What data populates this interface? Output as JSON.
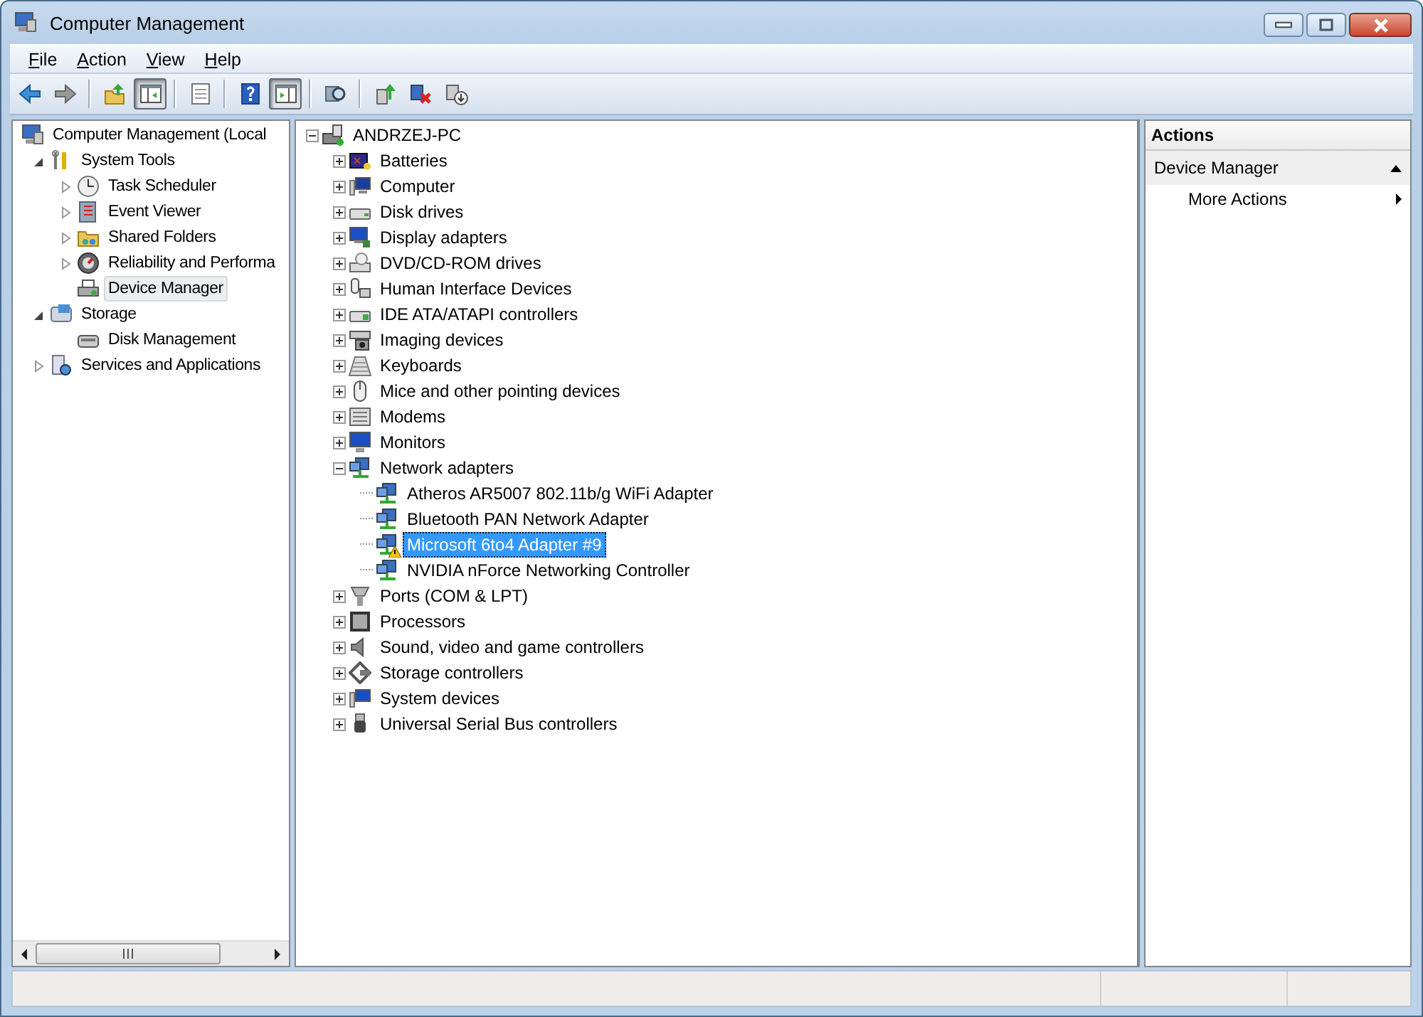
{
  "window": {
    "title": "Computer Management"
  },
  "menu": [
    {
      "label": "File"
    },
    {
      "label": "Action"
    },
    {
      "label": "View"
    },
    {
      "label": "Help"
    }
  ],
  "toolbar": [
    {
      "kind": "back",
      "pressed": false
    },
    {
      "kind": "forward",
      "pressed": false
    },
    {
      "kind": "separator"
    },
    {
      "kind": "up",
      "pressed": false
    },
    {
      "kind": "console-tree",
      "pressed": true
    },
    {
      "kind": "separator"
    },
    {
      "kind": "export",
      "pressed": false
    },
    {
      "kind": "separator"
    },
    {
      "kind": "help",
      "pressed": false
    },
    {
      "kind": "action-pane",
      "pressed": true
    },
    {
      "kind": "separator"
    },
    {
      "kind": "scan",
      "pressed": false
    },
    {
      "kind": "separator"
    },
    {
      "kind": "update",
      "pressed": false
    },
    {
      "kind": "uninstall",
      "pressed": false
    },
    {
      "kind": "disable",
      "pressed": false
    }
  ],
  "console_tree": {
    "items": [
      {
        "label": "Computer Management (Local",
        "kind": "computer-management",
        "selected": false,
        "children": [
          {
            "label": "System Tools",
            "kind": "tools",
            "expanded": true,
            "selected": false,
            "children": [
              {
                "label": "Task Scheduler",
                "kind": "clock",
                "expanded": false,
                "selected": false
              },
              {
                "label": "Event Viewer",
                "kind": "event",
                "expanded": false,
                "selected": false
              },
              {
                "label": "Shared Folders",
                "kind": "folder",
                "expanded": false,
                "selected": false
              },
              {
                "label": "Reliability and Performa",
                "kind": "gauge",
                "expanded": false,
                "selected": false
              },
              {
                "label": "Device Manager",
                "kind": "device-manager",
                "selected": true
              }
            ]
          },
          {
            "label": "Storage",
            "kind": "storage",
            "expanded": true,
            "selected": false,
            "children": [
              {
                "label": "Disk Management",
                "kind": "disk-management",
                "selected": false
              }
            ]
          },
          {
            "label": "Services and Applications",
            "kind": "services",
            "expanded": false,
            "selected": false
          }
        ]
      }
    ]
  },
  "device_tree": {
    "root": {
      "label": "ANDRZEJ-PC",
      "expanded": true,
      "selected": false,
      "children": [
        {
          "label": "Batteries",
          "kind": "battery",
          "expanded": false,
          "selected": false
        },
        {
          "label": "Computer",
          "kind": "computer",
          "expanded": false,
          "selected": false
        },
        {
          "label": "Disk drives",
          "kind": "disk",
          "expanded": false,
          "selected": false
        },
        {
          "label": "Display adapters",
          "kind": "display",
          "expanded": false,
          "selected": false
        },
        {
          "label": "DVD/CD-ROM drives",
          "kind": "dvd",
          "expanded": false,
          "selected": false
        },
        {
          "label": "Human Interface Devices",
          "kind": "hid",
          "expanded": false,
          "selected": false
        },
        {
          "label": "IDE ATA/ATAPI controllers",
          "kind": "ide",
          "expanded": false,
          "selected": false
        },
        {
          "label": "Imaging devices",
          "kind": "imaging",
          "expanded": false,
          "selected": false
        },
        {
          "label": "Keyboards",
          "kind": "keyboard",
          "expanded": false,
          "selected": false
        },
        {
          "label": "Mice and other pointing devices",
          "kind": "mouse",
          "expanded": false,
          "selected": false
        },
        {
          "label": "Modems",
          "kind": "modem",
          "expanded": false,
          "selected": false
        },
        {
          "label": "Monitors",
          "kind": "monitor",
          "expanded": false,
          "selected": false
        },
        {
          "label": "Network adapters",
          "kind": "network",
          "expanded": true,
          "selected": false,
          "children": [
            {
              "label": "Atheros AR5007 802.11b/g WiFi Adapter",
              "kind": "network",
              "warning": false,
              "selected": false
            },
            {
              "label": "Bluetooth PAN Network Adapter",
              "kind": "network",
              "warning": false,
              "selected": false
            },
            {
              "label": "Microsoft 6to4 Adapter #9",
              "kind": "network",
              "warning": true,
              "selected": true
            },
            {
              "label": "NVIDIA nForce Networking Controller",
              "kind": "network",
              "warning": false,
              "selected": false
            }
          ]
        },
        {
          "label": "Ports (COM & LPT)",
          "kind": "port",
          "expanded": false,
          "selected": false
        },
        {
          "label": "Processors",
          "kind": "processor",
          "expanded": false,
          "selected": false
        },
        {
          "label": "Sound, video and game controllers",
          "kind": "sound",
          "expanded": false,
          "selected": false
        },
        {
          "label": "Storage controllers",
          "kind": "storage-controller",
          "expanded": false,
          "selected": false
        },
        {
          "label": "System devices",
          "kind": "system",
          "expanded": false,
          "selected": false
        },
        {
          "label": "Universal Serial Bus controllers",
          "kind": "usb",
          "expanded": false,
          "selected": false
        }
      ]
    }
  },
  "actions": {
    "title": "Actions",
    "sections": [
      {
        "label": "Device Manager",
        "expanded": true,
        "items": [
          {
            "label": "More Actions",
            "submenu": true
          }
        ]
      }
    ]
  }
}
